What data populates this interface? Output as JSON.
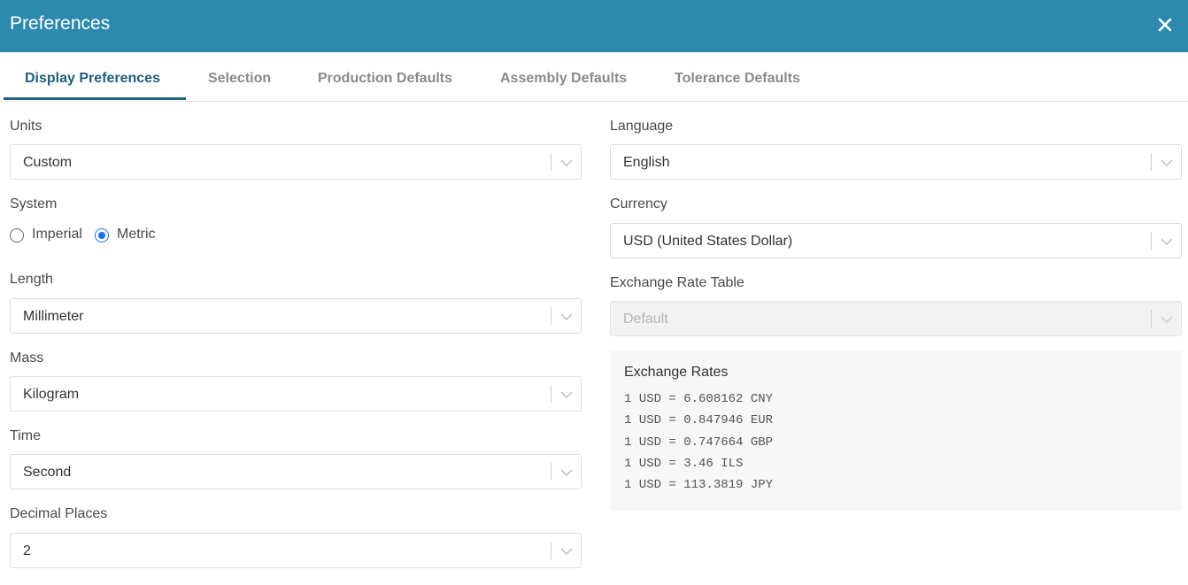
{
  "dialog": {
    "title": "Preferences",
    "close_icon": "close-icon",
    "accent_color": "#2d89ad"
  },
  "tabs": [
    {
      "label": "Display Preferences",
      "active": true
    },
    {
      "label": "Selection",
      "active": false
    },
    {
      "label": "Production Defaults",
      "active": false
    },
    {
      "label": "Assembly Defaults",
      "active": false
    },
    {
      "label": "Tolerance Defaults",
      "active": false
    }
  ],
  "left": {
    "units": {
      "label": "Units",
      "value": "Custom"
    },
    "system": {
      "label": "System",
      "options": [
        {
          "label": "Imperial",
          "checked": false
        },
        {
          "label": "Metric",
          "checked": true
        }
      ]
    },
    "length": {
      "label": "Length",
      "value": "Millimeter"
    },
    "mass": {
      "label": "Mass",
      "value": "Kilogram"
    },
    "time": {
      "label": "Time",
      "value": "Second"
    },
    "decimal_places": {
      "label": "Decimal Places",
      "value": "2"
    }
  },
  "right": {
    "language": {
      "label": "Language",
      "value": "English"
    },
    "currency": {
      "label": "Currency",
      "value": "USD (United States Dollar)"
    },
    "exchange_rate_table": {
      "label": "Exchange Rate Table",
      "value": "Default",
      "disabled": true
    },
    "exchange_rates": {
      "title": "Exchange Rates",
      "lines": [
        "1 USD = 6.608162 CNY",
        "1 USD = 0.847946 EUR",
        "1 USD = 0.747664 GBP",
        "1 USD = 3.46 ILS",
        "1 USD = 113.3819 JPY"
      ]
    }
  }
}
